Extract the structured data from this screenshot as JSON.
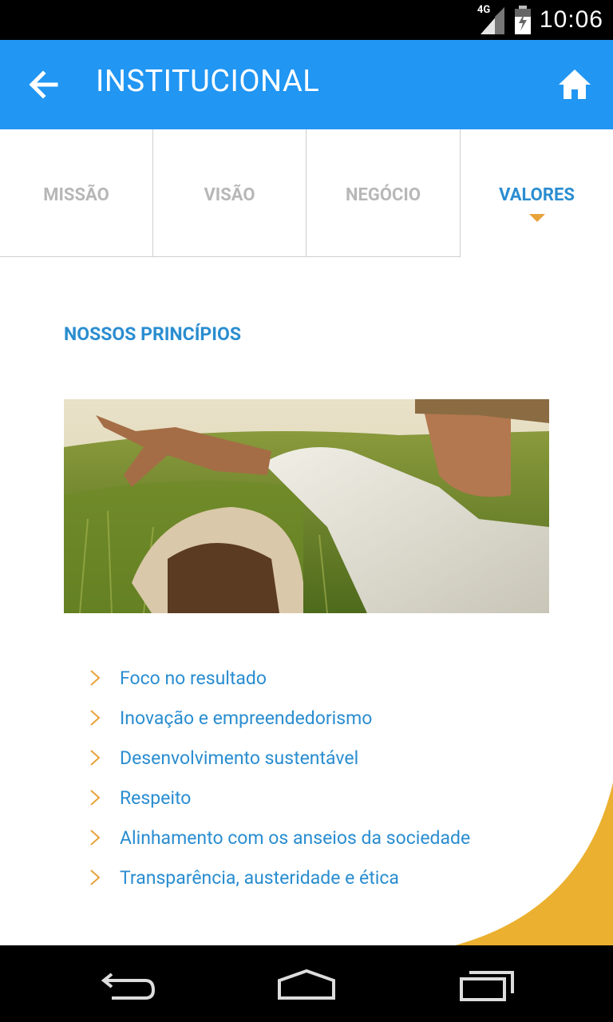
{
  "status_bar": {
    "time": "10:06",
    "network": "4G"
  },
  "app_bar": {
    "title": "INSTITUCIONAL",
    "back_icon": "arrow-left-icon",
    "home_icon": "home-icon"
  },
  "tabs": [
    {
      "label": "MISSÃO",
      "active": false
    },
    {
      "label": "VISÃO",
      "active": false
    },
    {
      "label": "NEGÓCIO",
      "active": false
    },
    {
      "label": "VALORES",
      "active": true
    }
  ],
  "section": {
    "title": "NOSSOS PRINCÍPIOS",
    "items": [
      "Foco no resultado",
      "Inovação e empreendedorismo",
      "Desenvolvimento sustentável",
      "Respeito",
      "Alinhamento com os anseios da sociedade",
      "Transparência, austeridade e ética"
    ]
  },
  "colors": {
    "primary": "#2196f3",
    "accent_text": "#2a8dd0",
    "accent_orange": "#e8a23b",
    "tab_inactive": "#b7b7b7"
  }
}
